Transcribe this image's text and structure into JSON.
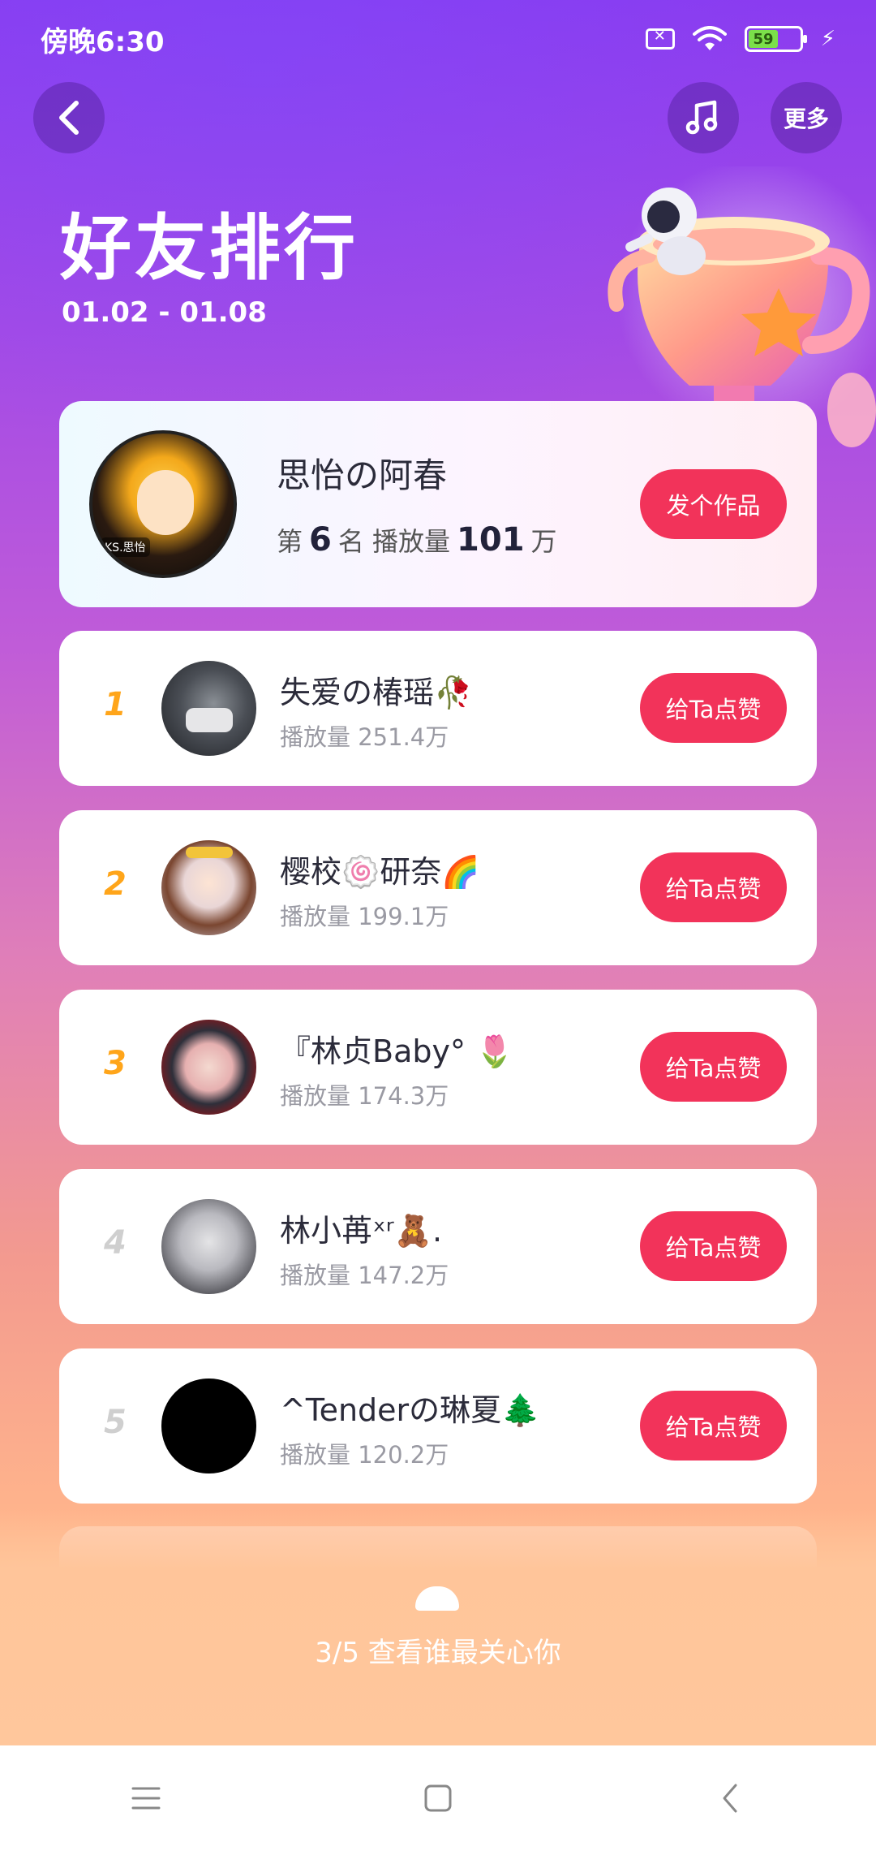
{
  "status_bar": {
    "time": "傍晚6:30",
    "battery": "59"
  },
  "header": {
    "back_icon": "chevron-left-icon",
    "music_icon": "music-note-icon",
    "more_label": "更多",
    "title": "好友排行",
    "date_range": "01.02 - 01.08"
  },
  "my_rank": {
    "name": "思怡の阿春",
    "avatar_tag": "KS.思怡",
    "rank_prefix": "第",
    "rank_number": "6",
    "rank_suffix": "名 播放量",
    "play_count": "101",
    "play_unit": "万",
    "button_label": "发个作品"
  },
  "friends": [
    {
      "rank": "1",
      "name": "失爱の椿瑶🥀",
      "play": "播放量 251.4万",
      "button": "给Ta点赞"
    },
    {
      "rank": "2",
      "name": "樱校🍥研奈🌈",
      "play": "播放量 199.1万",
      "button": "给Ta点赞"
    },
    {
      "rank": "3",
      "name": "『林贞Baby° 🌷",
      "play": "播放量 174.3万",
      "button": "给Ta点赞"
    },
    {
      "rank": "4",
      "name": "林小苒ˣʳ🧸.",
      "play": "播放量 147.2万",
      "button": "给Ta点赞"
    },
    {
      "rank": "5",
      "name": "^Tenderの琳夏🌲",
      "play": "播放量 120.2万",
      "button": "给Ta点赞"
    }
  ],
  "footer": {
    "reveal_text": "3/5 查看谁最关心你"
  },
  "colors": {
    "accent_button": "#f2335a",
    "rank_gold": "#ffa51a",
    "rank_grey": "#cfcfcf"
  }
}
